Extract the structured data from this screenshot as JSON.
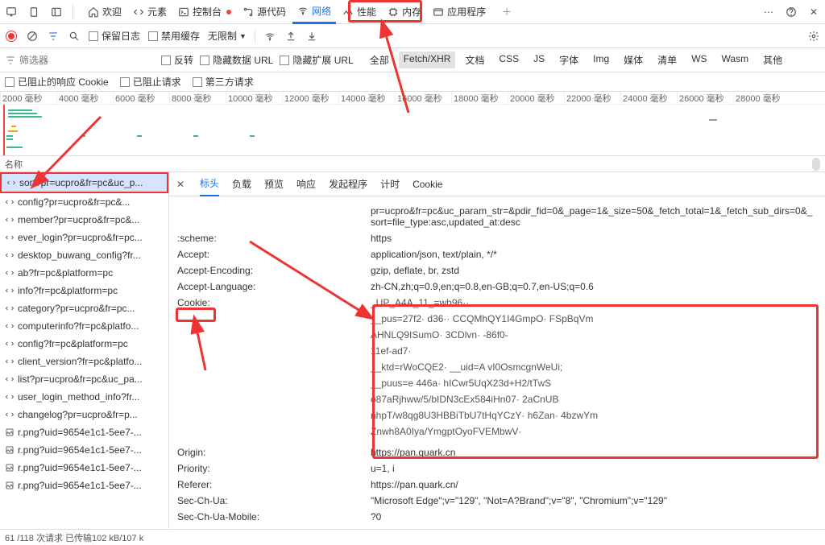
{
  "topTabs": {
    "items": [
      {
        "label": "欢迎",
        "icon": "home"
      },
      {
        "label": "元素",
        "icon": "code"
      },
      {
        "label": "控制台",
        "icon": "console",
        "badge": true
      },
      {
        "label": "源代码",
        "icon": "source"
      },
      {
        "label": "网络",
        "icon": "wifi",
        "active": true
      },
      {
        "label": "性能",
        "icon": "perf"
      },
      {
        "label": "内存",
        "icon": "memory"
      },
      {
        "label": "应用程序",
        "icon": "app"
      }
    ]
  },
  "toolbar": {
    "keepLog": "保留日志",
    "disableCache": "禁用缓存",
    "noLimit": "无限制"
  },
  "filter": {
    "placeholder": "筛选器",
    "invert": "反转",
    "hideDataUrl": "隐藏数据 URL",
    "hideExtUrl": "隐藏扩展 URL",
    "chips": [
      "全部",
      "Fetch/XHR",
      "文档",
      "CSS",
      "JS",
      "字体",
      "Img",
      "媒体",
      "清单",
      "WS",
      "Wasm",
      "其他"
    ],
    "activeChip": 1
  },
  "blockbar": {
    "items": [
      "已阻止的响应 Cookie",
      "已阻止请求",
      "第三方请求"
    ]
  },
  "timeline": {
    "ticks": [
      "2000 毫秒",
      "4000 毫秒",
      "6000 毫秒",
      "8000 毫秒",
      "10000 毫秒",
      "12000 毫秒",
      "14000 毫秒",
      "16000 毫秒",
      "18000 毫秒",
      "20000 毫秒",
      "22000 毫秒",
      "24000 毫秒",
      "26000 毫秒",
      "28000 毫秒"
    ]
  },
  "nameHeader": "名称",
  "requests": [
    {
      "icon": "js",
      "name": "sort?pr=ucpro&fr=pc&uc_p...",
      "hl": true,
      "selected": true
    },
    {
      "icon": "js",
      "name": "config?pr=ucpro&fr=pc&..."
    },
    {
      "icon": "js",
      "name": "member?pr=ucpro&fr=pc&..."
    },
    {
      "icon": "js",
      "name": "ever_login?pr=ucpro&fr=pc..."
    },
    {
      "icon": "js",
      "name": "desktop_buwang_config?fr..."
    },
    {
      "icon": "js",
      "name": "ab?fr=pc&platform=pc"
    },
    {
      "icon": "js",
      "name": "info?fr=pc&platform=pc"
    },
    {
      "icon": "js",
      "name": "category?pr=ucpro&fr=pc..."
    },
    {
      "icon": "js",
      "name": "computerinfo?fr=pc&platfo..."
    },
    {
      "icon": "js",
      "name": "config?fr=pc&platform=pc"
    },
    {
      "icon": "js",
      "name": "client_version?fr=pc&platfo..."
    },
    {
      "icon": "js",
      "name": "list?pr=ucpro&fr=pc&uc_pa..."
    },
    {
      "icon": "js",
      "name": "user_login_method_info?fr..."
    },
    {
      "icon": "js",
      "name": "changelog?pr=ucpro&fr=p..."
    },
    {
      "icon": "img",
      "name": "r.png?uid=9654e1c1-5ee7-..."
    },
    {
      "icon": "img",
      "name": "r.png?uid=9654e1c1-5ee7-..."
    },
    {
      "icon": "img",
      "name": "r.png?uid=9654e1c1-5ee7-..."
    },
    {
      "icon": "img",
      "name": "r.png?uid=9654e1c1-5ee7-..."
    }
  ],
  "detail": {
    "tabs": [
      "标头",
      "负载",
      "预览",
      "响应",
      "发起程序",
      "计时",
      "Cookie"
    ],
    "activeTab": 0,
    "prLine": "pr=ucpro&fr=pc&uc_param_str=&pdir_fid=0&_page=1&_size=50&_fetch_total=1&_fetch_sub_dirs=0&_sort=file_type:asc,updated_at:desc",
    "headers": [
      {
        "k": ":scheme:",
        "v": "https"
      },
      {
        "k": "Accept:",
        "v": "application/json, text/plain, */*"
      },
      {
        "k": "Accept-Encoding:",
        "v": "gzip, deflate, br, zstd"
      },
      {
        "k": "Accept-Language:",
        "v": "zh-CN,zh;q=0.9,en;q=0.8,en-GB;q=0.7,en-US;q=0.6"
      },
      {
        "k": "Cookie:",
        "v": "",
        "cookie": true
      },
      {
        "k": "Origin:",
        "v": "https://pan.quark.cn"
      },
      {
        "k": "Priority:",
        "v": "u=1, i"
      },
      {
        "k": "Referer:",
        "v": "https://pan.quark.cn/"
      },
      {
        "k": "Sec-Ch-Ua:",
        "v": "\"Microsoft Edge\";v=\"129\", \"Not=A?Brand\";v=\"8\", \"Chromium\";v=\"129\""
      },
      {
        "k": "Sec-Ch-Ua-Mobile:",
        "v": "?0"
      }
    ],
    "cookieLines": [
      "_UP_A4A_11_=wb96··",
      "__pus=27f2·            d36··                          CCQMhQY1I4GmpO·           FSpBqVm",
      "AHNLQ9ISumO·                                 3CDlvn·                           -86f0-",
      "11ef-ad7·",
      "__ktd=rWoCQE2·                             __uid=A              vI0OsmcgnWeUi;",
      "__puus=e                              446a·                      hICwr5UqX23d+H2/tTwS",
      "o87aRjhww/5/bIDN3cEx584iHn07·                                             2aCnUB",
      "nhpT/w8qg8U3HBBiTbU7tHqYCzY·    h6Zan·                                  4bzwYm",
      "Znwh8A0Iya/YmgptOyoFVEMbwV·"
    ]
  },
  "status": "61 /118 次请求  已传输102 kB/107 k"
}
